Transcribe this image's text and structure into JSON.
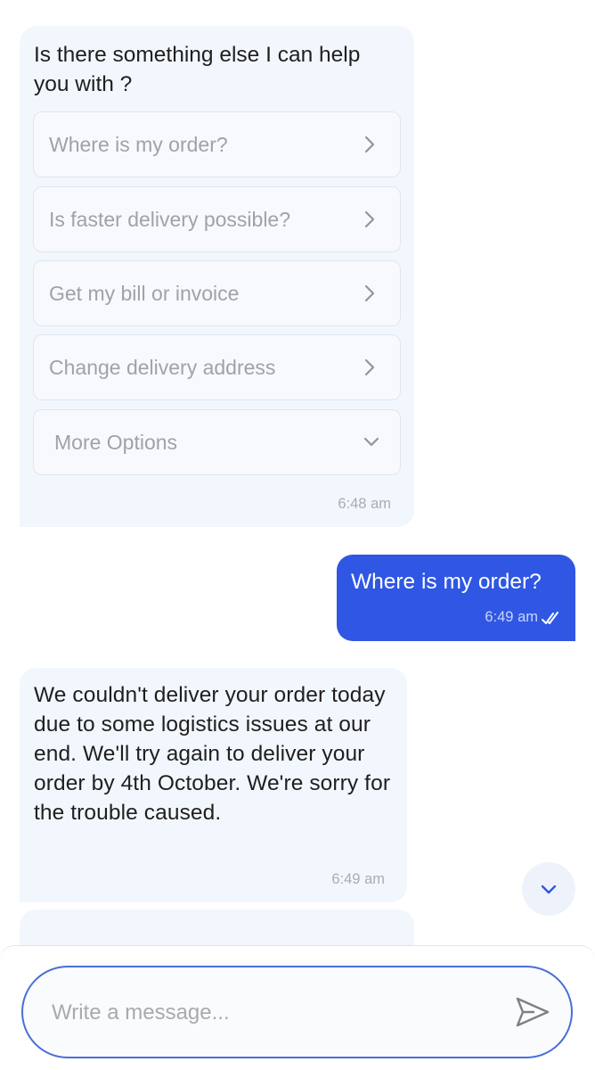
{
  "bot_message_1": {
    "text": "Is there something else I can help you with ?",
    "time": "6:48 am",
    "options": [
      {
        "label": "Where is my order?",
        "icon": "chevron-right-icon"
      },
      {
        "label": "Is faster delivery possible?",
        "icon": "chevron-right-icon"
      },
      {
        "label": "Get my bill or invoice",
        "icon": "chevron-right-icon"
      },
      {
        "label": "Change delivery address",
        "icon": "chevron-right-icon"
      },
      {
        "label": "More Options",
        "icon": "chevron-down-icon"
      }
    ]
  },
  "user_message": {
    "text": "Where is my order?",
    "time": "6:49 am",
    "status_icon": "double-check-icon"
  },
  "bot_message_2": {
    "text": "We couldn't deliver your order today due to some logistics issues at our end. We'll try again to deliver your order by 4th October. We're sorry for the trouble caused.",
    "time": "6:49 am"
  },
  "scroll_button": {
    "icon": "chevron-down-icon"
  },
  "composer": {
    "placeholder": "Write a message...",
    "send_icon": "send-icon"
  },
  "colors": {
    "bot_bubble": "#f2f7fd",
    "user_bubble": "#2f57e4",
    "input_border": "#4a6ed7",
    "accent": "#2f57e4"
  }
}
